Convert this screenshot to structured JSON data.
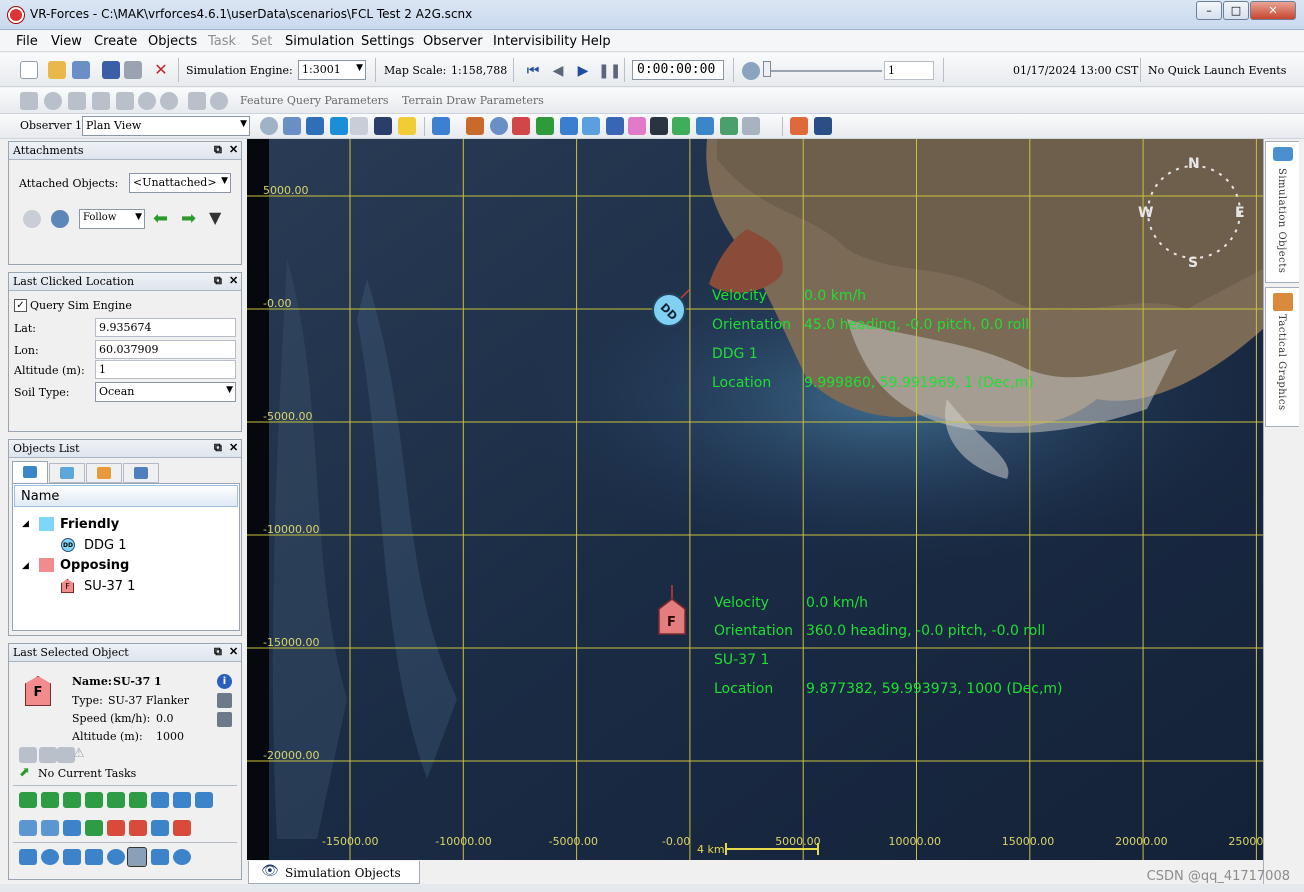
{
  "window": {
    "title": "VR-Forces - C:\\MAK\\vrforces4.6.1\\userData\\scenarios\\FCL Test 2 A2G.scnx",
    "min": "–",
    "max": "□",
    "close": "✕"
  },
  "menu": [
    "File",
    "View",
    "Create",
    "Objects",
    "Task",
    "Set",
    "Simulation",
    "Settings",
    "Observer",
    "Intervisibility",
    "Help"
  ],
  "toolbar": {
    "sim_engine_label": "Simulation Engine:",
    "sim_engine_value": "1:3001",
    "map_scale_label": "Map Scale:",
    "map_scale_value": "1:158,788",
    "clock": "0:00:00:00",
    "speed_value": "1",
    "datetime": "01/17/2024 13:00 CST",
    "quick_launch": "No Quick Launch Events",
    "feature_query": "Feature Query Parameters",
    "terrain_draw": "Terrain Draw Parameters",
    "observer_label": "Observer 1",
    "view_value": "Plan View"
  },
  "attachments": {
    "header": "Attachments",
    "attached_label": "Attached Objects:",
    "attached_value": "<Unattached>",
    "follow_value": "Follow"
  },
  "last_clicked": {
    "header": "Last Clicked Location",
    "query_label": "Query Sim Engine",
    "lat_label": "Lat:",
    "lat_value": "9.935674",
    "lon_label": "Lon:",
    "lon_value": "60.037909",
    "alt_label": "Altitude (m):",
    "alt_value": "1",
    "soil_label": "Soil Type:",
    "soil_value": "Ocean"
  },
  "objects_list": {
    "header": "Objects List",
    "column": "Name",
    "friendly": "Friendly",
    "friendly_item": "DDG 1",
    "opposing": "Opposing",
    "opposing_item": "SU-37 1",
    "friendly_color": "#7fd6f8",
    "opposing_color": "#f28b8b"
  },
  "selected": {
    "header": "Last Selected Object",
    "name_label": "Name:",
    "name_value": "SU-37 1",
    "type_label": "Type:",
    "type_value": "SU-37 Flanker",
    "speed_label": "Speed (km/h):",
    "speed_value": "0.0",
    "alt_label": "Altitude (m):",
    "alt_value": "1000",
    "tasks": "No Current Tasks",
    "icon_letter": "F"
  },
  "map": {
    "y_labels": [
      "5000.00",
      "-0.00",
      "-5000.00",
      "-10000.00",
      "-15000.00",
      "-20000.00"
    ],
    "x_labels": [
      "-15000.00",
      "-10000.00",
      "-5000.00",
      "-0.00",
      "5000.00",
      "10000.00",
      "15000.00",
      "20000.00",
      "25000.00"
    ],
    "scale_label": "4 km",
    "compass": {
      "n": "N",
      "s": "S",
      "e": "E",
      "w": "W"
    },
    "ddg": {
      "symbol": "DD",
      "velocity_label": "Velocity",
      "velocity_value": "0.0 km/h",
      "orientation_label": "Orientation",
      "orientation_value": "45.0 heading, -0.0 pitch, 0.0 roll",
      "name": "DDG 1",
      "location_label": "Location",
      "location_value": "9.999860, 59.991969, 1 (Dec,m)"
    },
    "su": {
      "symbol": "F",
      "velocity_label": "Velocity",
      "velocity_value": "0.0 km/h",
      "orientation_label": "Orientation",
      "orientation_value": "360.0 heading, -0.0 pitch, -0.0 roll",
      "name": "SU-37 1",
      "location_label": "Location",
      "location_value": "9.877382, 59.993973, 1000 (Dec,m)"
    },
    "grid_color": "#c9c23a",
    "label_green": "#1fdf31"
  },
  "right_tabs": [
    "Simulation Objects",
    "Tactical Graphics"
  ],
  "bottom_tab": "Simulation Objects",
  "watermark": "CSDN @qq_41717008"
}
